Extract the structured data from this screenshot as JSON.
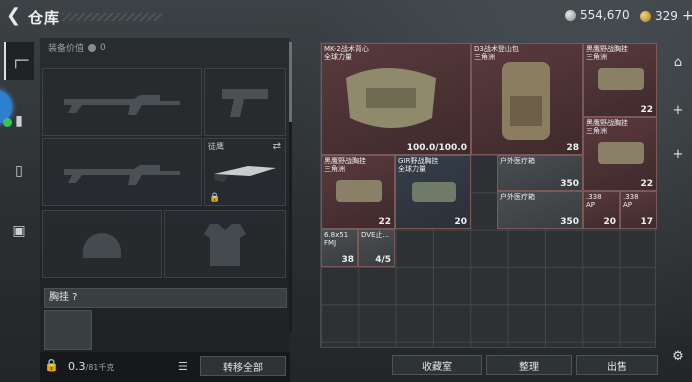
{
  "header": {
    "back_icon": "back-arrow-icon",
    "title": "仓库",
    "silver": "554,670",
    "gold": "329",
    "plus": "+"
  },
  "left_tabs": [
    {
      "icon": "gun-icon"
    },
    {
      "icon": "helmet-icon"
    },
    {
      "icon": "backpack-icon"
    },
    {
      "icon": "briefcase-icon"
    }
  ],
  "equipment": {
    "header_label": "装备价值",
    "header_value": "0",
    "melee_label": "徒鹰",
    "vest_label": "胸挂 ?"
  },
  "bottom": {
    "capacity": "0.3",
    "capacity_max": "/81千克",
    "transfer_all": "转移全部"
  },
  "stash_buttons": {
    "collection": "收藏室",
    "sort": "整理",
    "sell": "出售"
  },
  "items": [
    {
      "name": "MK-2战术背心\n全球力量",
      "count": "100.0/100.0",
      "color": "red"
    },
    {
      "name": "D3战术登山包\n三角洲",
      "count": "28",
      "color": "red"
    },
    {
      "name": "黑鹰野战胸挂\n三角洲",
      "count": "22",
      "color": "red"
    },
    {
      "name": "黑鹰野战胸挂\n三角洲",
      "count": "22",
      "color": "red"
    },
    {
      "name": "黑鹰野战胸挂\n三角洲",
      "count": "22",
      "color": "red"
    },
    {
      "name": "GIR野战胸挂\n全球力量",
      "count": "20",
      "color": "blue"
    },
    {
      "name": "户外医疗箱",
      "count": "350",
      "color": "grey"
    },
    {
      "name": "户外医疗箱",
      "count": "350",
      "color": "grey"
    },
    {
      "name": ".338\nAP",
      "count": "20",
      "color": "red"
    },
    {
      "name": ".338\nAP",
      "count": "17",
      "color": "red"
    },
    {
      "name": "6.8x51\nFMJ",
      "count": "38",
      "color": "grey"
    },
    {
      "name": "DVE止...",
      "count": "4/5",
      "color": "grey"
    }
  ]
}
